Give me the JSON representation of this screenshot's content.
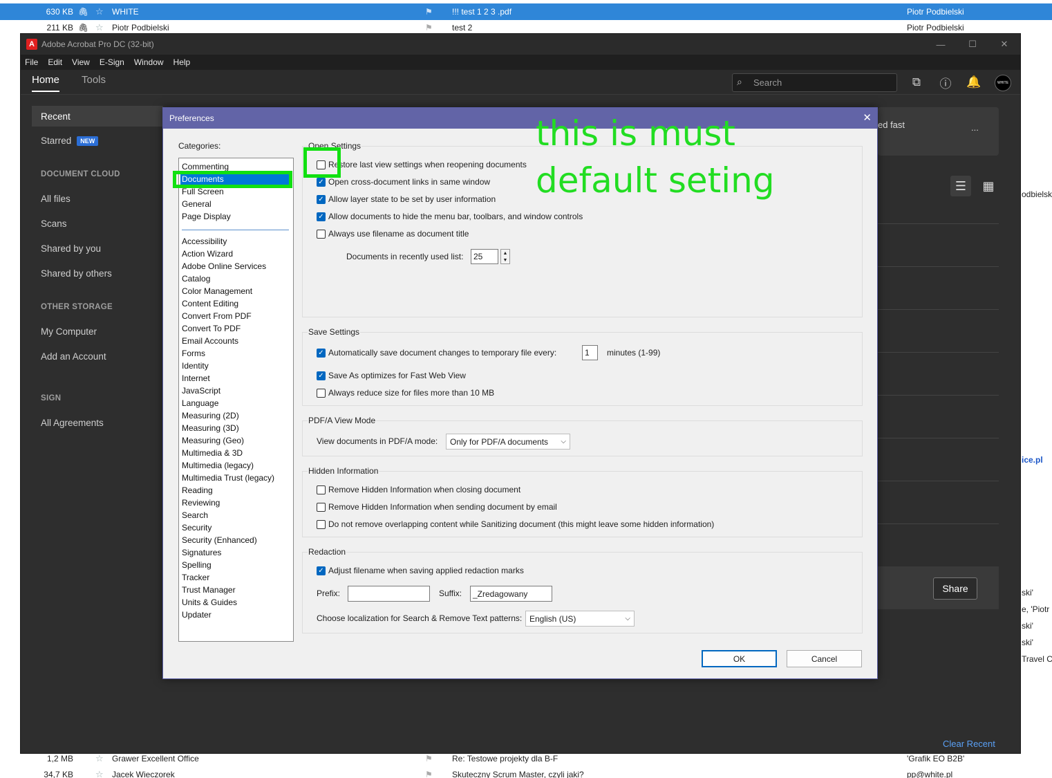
{
  "mail": {
    "rows_top": [
      {
        "size": "630 KB",
        "from": "WHITE",
        "subject": "!!! test 1 2 3 .pdf",
        "to": "Piotr Podbielski"
      },
      {
        "size": "211 KB",
        "from": "Piotr Podbielski",
        "subject": "test 2",
        "to": "Piotr Podbielski"
      }
    ],
    "rows_bottom": [
      {
        "size": "1,2 MB",
        "from": "Grawer Excellent Office",
        "subject": "Re: Testowe projekty dla B-F",
        "to": "'Grafik EO B2B'"
      },
      {
        "size": "34,7 KB",
        "from": "Jacek Wieczorek",
        "subject": "Skuteczny Scrum Master, czyli jaki?",
        "to": "pp@white.pl"
      }
    ],
    "right_peek": [
      "odbielski",
      "ice.pl",
      "ski'",
      "e, 'Piotr P",
      "ski'",
      "ski'",
      "Travel C"
    ]
  },
  "window": {
    "title": "Adobe Acrobat Pro DC (32-bit)",
    "menu": [
      "File",
      "Edit",
      "View",
      "E-Sign",
      "Window",
      "Help"
    ],
    "tabs": [
      "Home",
      "Tools"
    ],
    "search_placeholder": "Search"
  },
  "sidebar": {
    "recent": "Recent",
    "starred": "Starred",
    "new_badge": "NEW",
    "doc_cloud_head": "DOCUMENT CLOUD",
    "doc_cloud_items": [
      "All files",
      "Scans",
      "Shared by you",
      "Shared by others"
    ],
    "other_storage_head": "OTHER STORAGE",
    "other_storage_items": [
      "My Computer",
      "Add an Account"
    ],
    "sign_head": "SIGN",
    "sign_items": [
      "All Agreements"
    ]
  },
  "home": {
    "banner_text": "ed fast",
    "banner_more": "...",
    "share": "Share",
    "clear_recent": "Clear Recent"
  },
  "dialog": {
    "title": "Preferences",
    "categories_label": "Categories:",
    "categories_top": [
      "Commenting",
      "Documents",
      "Full Screen",
      "General",
      "Page Display"
    ],
    "categories": [
      "Accessibility",
      "Action Wizard",
      "Adobe Online Services",
      "Catalog",
      "Color Management",
      "Content Editing",
      "Convert From PDF",
      "Convert To PDF",
      "Email Accounts",
      "Forms",
      "Identity",
      "Internet",
      "JavaScript",
      "Language",
      "Measuring (2D)",
      "Measuring (3D)",
      "Measuring (Geo)",
      "Multimedia & 3D",
      "Multimedia (legacy)",
      "Multimedia Trust (legacy)",
      "Reading",
      "Reviewing",
      "Search",
      "Security",
      "Security (Enhanced)",
      "Signatures",
      "Spelling",
      "Tracker",
      "Trust Manager",
      "Units & Guides",
      "Updater"
    ],
    "selected_category": "Documents",
    "open_settings": {
      "title": "Open Settings",
      "options": [
        {
          "label": "Restore last view settings when reopening documents",
          "checked": false
        },
        {
          "label": "Open cross-document links in same window",
          "checked": true
        },
        {
          "label": "Allow layer state to be set by user information",
          "checked": true
        },
        {
          "label": "Allow documents to hide the menu bar, toolbars, and window controls",
          "checked": true
        },
        {
          "label": "Always use filename as document title",
          "checked": false
        }
      ],
      "recent_list_label": "Documents in recently used list:",
      "recent_list_value": "25"
    },
    "save_settings": {
      "title": "Save Settings",
      "autosave_label": "Automatically save document changes to temporary file every:",
      "autosave_checked": true,
      "autosave_value": "1",
      "autosave_unit": "minutes (1-99)",
      "fastweb_label": "Save As optimizes for Fast Web View",
      "fastweb_checked": true,
      "reduce_label": "Always reduce size for files more than 10 MB",
      "reduce_checked": false
    },
    "pdfa": {
      "title": "PDF/A View Mode",
      "label": "View documents in PDF/A mode:",
      "value": "Only for PDF/A documents"
    },
    "hidden_info": {
      "title": "Hidden Information",
      "options": [
        {
          "label": "Remove Hidden Information when closing document",
          "checked": false
        },
        {
          "label": "Remove Hidden Information when sending document by email",
          "checked": false
        },
        {
          "label": "Do not remove overlapping content while Sanitizing document (this might leave some hidden information)",
          "checked": false
        }
      ]
    },
    "redaction": {
      "title": "Redaction",
      "adjust_label": "Adjust filename when saving applied redaction marks",
      "adjust_checked": true,
      "prefix_label": "Prefix:",
      "prefix_value": "",
      "suffix_label": "Suffix:",
      "suffix_value": "_Zredagowany",
      "locale_label": "Choose localization for Search & Remove Text patterns:",
      "locale_value": "English (US)"
    },
    "ok": "OK",
    "cancel": "Cancel"
  },
  "annotation": {
    "line1": "this is must",
    "line2": "default seting",
    "color": "#22dd22"
  }
}
